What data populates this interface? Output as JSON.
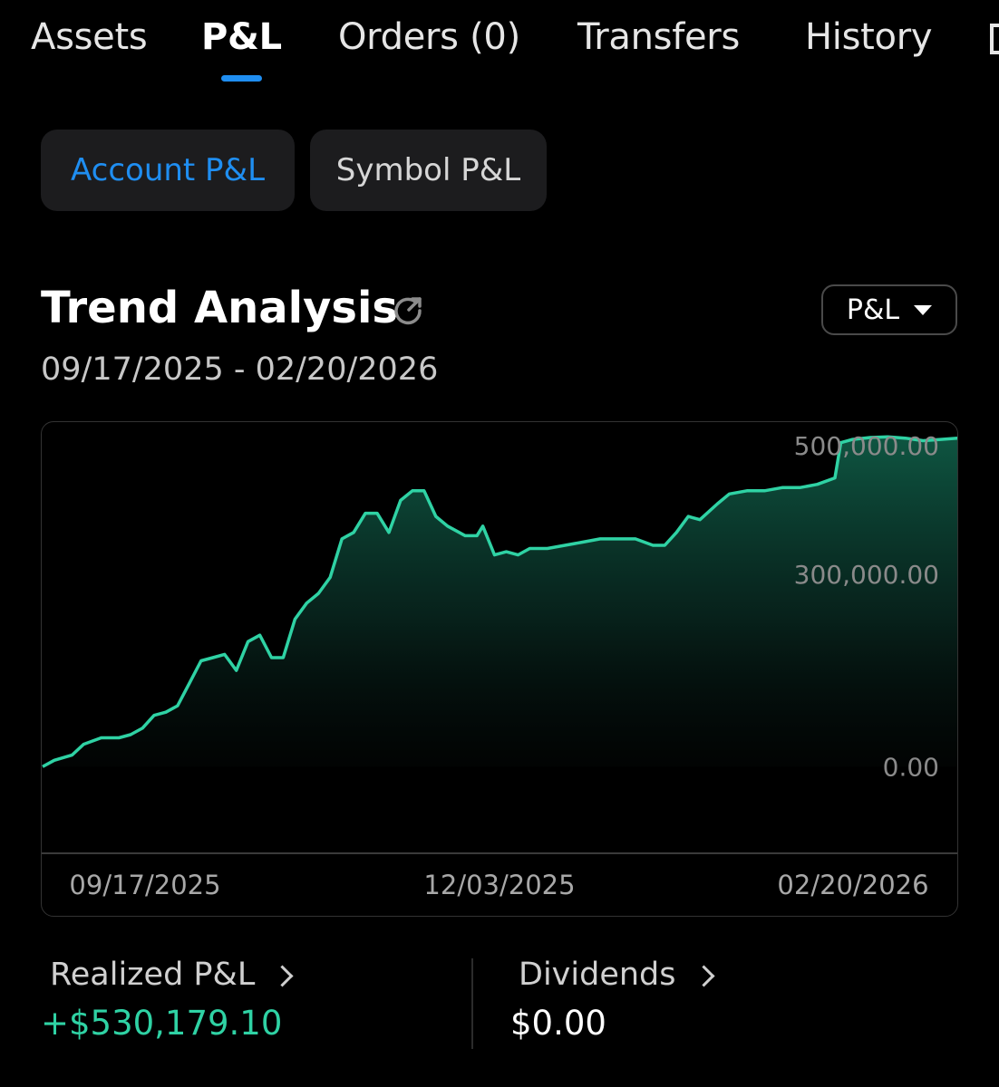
{
  "tabs": [
    {
      "label": "Assets"
    },
    {
      "label": "P&L",
      "active": true
    },
    {
      "label": "Orders (0)"
    },
    {
      "label": "Transfers"
    },
    {
      "label": "History"
    }
  ],
  "segments": {
    "account": "Account P&L",
    "symbol": "Symbol P&L"
  },
  "trend": {
    "title": "Trend Analysis",
    "share_icon": "share-external-icon",
    "dropdown_value": "P&L",
    "date_range": "09/17/2025 - 02/20/2026"
  },
  "stats": {
    "realized_label": "Realized P&L",
    "realized_value": "+$530,179.10",
    "dividends_label": "Dividends",
    "dividends_value": "$0.00"
  },
  "colors": {
    "accent": "#1f8ef1",
    "positive": "#2fd2a4",
    "background": "#000000"
  },
  "chart_data": {
    "type": "area",
    "xlabel": "",
    "ylabel": "",
    "x_tick_labels": [
      "09/17/2025",
      "12/03/2025",
      "02/20/2026"
    ],
    "y_tick_labels": [
      "500,000.00",
      "300,000.00",
      "0.00"
    ],
    "y_tick_values": [
      500000,
      300000,
      0
    ],
    "ylim": [
      -135000,
      537000
    ],
    "x_range": [
      "2025-09-17",
      "2026-02-20"
    ],
    "grid": false,
    "series": [
      {
        "values": [
          [
            "2025-09-17",
            0
          ],
          [
            "2025-09-19",
            10000
          ],
          [
            "2025-09-22",
            18000
          ],
          [
            "2025-09-24",
            35000
          ],
          [
            "2025-09-27",
            45000
          ],
          [
            "2025-09-30",
            45000
          ],
          [
            "2025-10-02",
            50000
          ],
          [
            "2025-10-04",
            60000
          ],
          [
            "2025-10-06",
            80000
          ],
          [
            "2025-10-08",
            85000
          ],
          [
            "2025-10-10",
            95000
          ],
          [
            "2025-10-12",
            130000
          ],
          [
            "2025-10-14",
            165000
          ],
          [
            "2025-10-16",
            170000
          ],
          [
            "2025-10-18",
            175000
          ],
          [
            "2025-10-20",
            150000
          ],
          [
            "2025-10-22",
            195000
          ],
          [
            "2025-10-24",
            205000
          ],
          [
            "2025-10-26",
            170000
          ],
          [
            "2025-10-28",
            170000
          ],
          [
            "2025-10-30",
            230000
          ],
          [
            "2025-11-01",
            255000
          ],
          [
            "2025-11-03",
            270000
          ],
          [
            "2025-11-05",
            295000
          ],
          [
            "2025-11-07",
            355000
          ],
          [
            "2025-11-09",
            365000
          ],
          [
            "2025-11-11",
            395000
          ],
          [
            "2025-11-13",
            395000
          ],
          [
            "2025-11-15",
            365000
          ],
          [
            "2025-11-17",
            415000
          ],
          [
            "2025-11-19",
            430000
          ],
          [
            "2025-11-21",
            430000
          ],
          [
            "2025-11-23",
            390000
          ],
          [
            "2025-11-25",
            375000
          ],
          [
            "2025-11-28",
            360000
          ],
          [
            "2025-11-30",
            360000
          ],
          [
            "2025-12-01",
            375000
          ],
          [
            "2025-12-03",
            330000
          ],
          [
            "2025-12-05",
            335000
          ],
          [
            "2025-12-07",
            330000
          ],
          [
            "2025-12-09",
            340000
          ],
          [
            "2025-12-12",
            340000
          ],
          [
            "2025-12-15",
            345000
          ],
          [
            "2025-12-18",
            350000
          ],
          [
            "2025-12-21",
            355000
          ],
          [
            "2025-12-24",
            355000
          ],
          [
            "2025-12-27",
            355000
          ],
          [
            "2025-12-30",
            345000
          ],
          [
            "2026-01-01",
            345000
          ],
          [
            "2026-01-03",
            365000
          ],
          [
            "2026-01-05",
            390000
          ],
          [
            "2026-01-07",
            385000
          ],
          [
            "2026-01-10",
            410000
          ],
          [
            "2026-01-12",
            425000
          ],
          [
            "2026-01-15",
            430000
          ],
          [
            "2026-01-18",
            430000
          ],
          [
            "2026-01-21",
            435000
          ],
          [
            "2026-01-24",
            435000
          ],
          [
            "2026-01-27",
            440000
          ],
          [
            "2026-01-30",
            450000
          ],
          [
            "2026-01-31",
            505000
          ],
          [
            "2026-02-02",
            510000
          ],
          [
            "2026-02-05",
            513000
          ],
          [
            "2026-02-08",
            514000
          ],
          [
            "2026-02-11",
            512000
          ],
          [
            "2026-02-14",
            508000
          ],
          [
            "2026-02-17",
            510000
          ],
          [
            "2026-02-20",
            512000
          ]
        ]
      }
    ]
  }
}
